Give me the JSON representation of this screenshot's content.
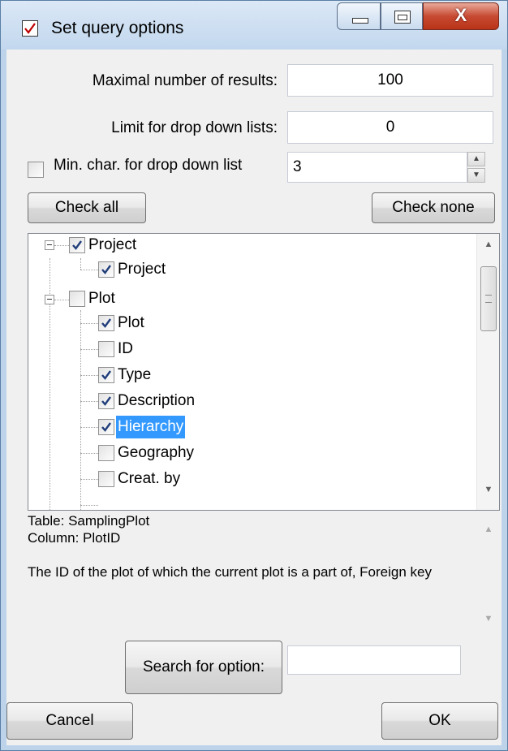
{
  "window": {
    "title": "Set query options",
    "close_glyph": "X"
  },
  "options": {
    "max_results_label": "Maximal number of results:",
    "max_results_value": "100",
    "dropdown_limit_label": "Limit for drop down lists:",
    "dropdown_limit_value": "0",
    "min_char_label": "Min. char. for drop down list",
    "min_char_value": "3",
    "min_char_checked": false
  },
  "buttons": {
    "check_all": "Check all",
    "check_none": "Check none",
    "search": "Search for option:",
    "cancel": "Cancel",
    "ok": "OK"
  },
  "tree": {
    "nodes": [
      {
        "label": "Project",
        "checked": true
      },
      {
        "label": "Project",
        "checked": true
      },
      {
        "label": "Plot",
        "checked": false
      },
      {
        "label": "Plot",
        "checked": true
      },
      {
        "label": "ID",
        "checked": false
      },
      {
        "label": "Type",
        "checked": true
      },
      {
        "label": "Description",
        "checked": true
      },
      {
        "label": "Hierarchy",
        "checked": true,
        "selected": true
      },
      {
        "label": "Geography",
        "checked": false
      },
      {
        "label": "Creat. by",
        "checked": false
      }
    ]
  },
  "description": {
    "table": "Table: SamplingPlot",
    "column": "Column: PlotID",
    "text": "The ID of the plot of which the current plot is a part of, Foreign key"
  },
  "search": {
    "value": ""
  },
  "colors": {
    "selection": "#3399ff",
    "dialog_bg": "#f0f0f0",
    "frame": "#bcd3ea"
  }
}
